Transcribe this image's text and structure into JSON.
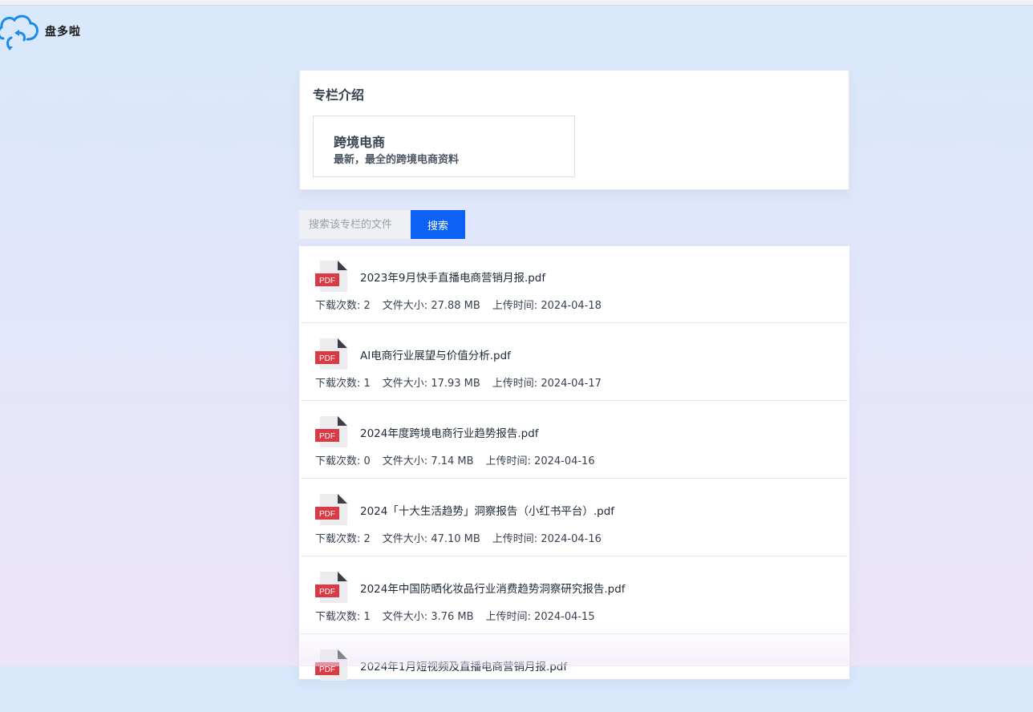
{
  "brand": {
    "name": "盘多啦",
    "logo_icon": "cloud-sync-icon",
    "accent": "#1a8be8"
  },
  "intro": {
    "title": "专栏介绍",
    "column_name": "跨境电商",
    "column_desc": "最新，最全的跨境电商资料"
  },
  "search": {
    "placeholder": "搜索该专栏的文件",
    "button_label": "搜索",
    "button_color": "#0b62f5"
  },
  "meta_labels": {
    "downloads": "下载次数: ",
    "size": "文件大小: ",
    "uploaded": "上传时间: "
  },
  "files": [
    {
      "icon": "pdf-icon",
      "name": "2023年9月快手直播电商营销月报.pdf",
      "downloads": "2",
      "size": "27.88 MB",
      "uploaded": "2024-04-18"
    },
    {
      "icon": "pdf-icon",
      "name": "AI电商行业展望与价值分析.pdf",
      "downloads": "1",
      "size": "17.93 MB",
      "uploaded": "2024-04-17"
    },
    {
      "icon": "pdf-icon",
      "name": "2024年度跨境电商行业趋势报告.pdf",
      "downloads": "0",
      "size": "7.14 MB",
      "uploaded": "2024-04-16"
    },
    {
      "icon": "pdf-icon",
      "name": "2024「十大生活趋势」洞察报告（小红书平台）.pdf",
      "downloads": "2",
      "size": "47.10 MB",
      "uploaded": "2024-04-16"
    },
    {
      "icon": "pdf-icon",
      "name": "2024年中国防晒化妆品行业消费趋势洞察研究报告.pdf",
      "downloads": "1",
      "size": "3.76 MB",
      "uploaded": "2024-04-15"
    },
    {
      "icon": "pdf-icon",
      "name": "2024年1月短视频及直播电商营销月报.pdf"
    }
  ]
}
